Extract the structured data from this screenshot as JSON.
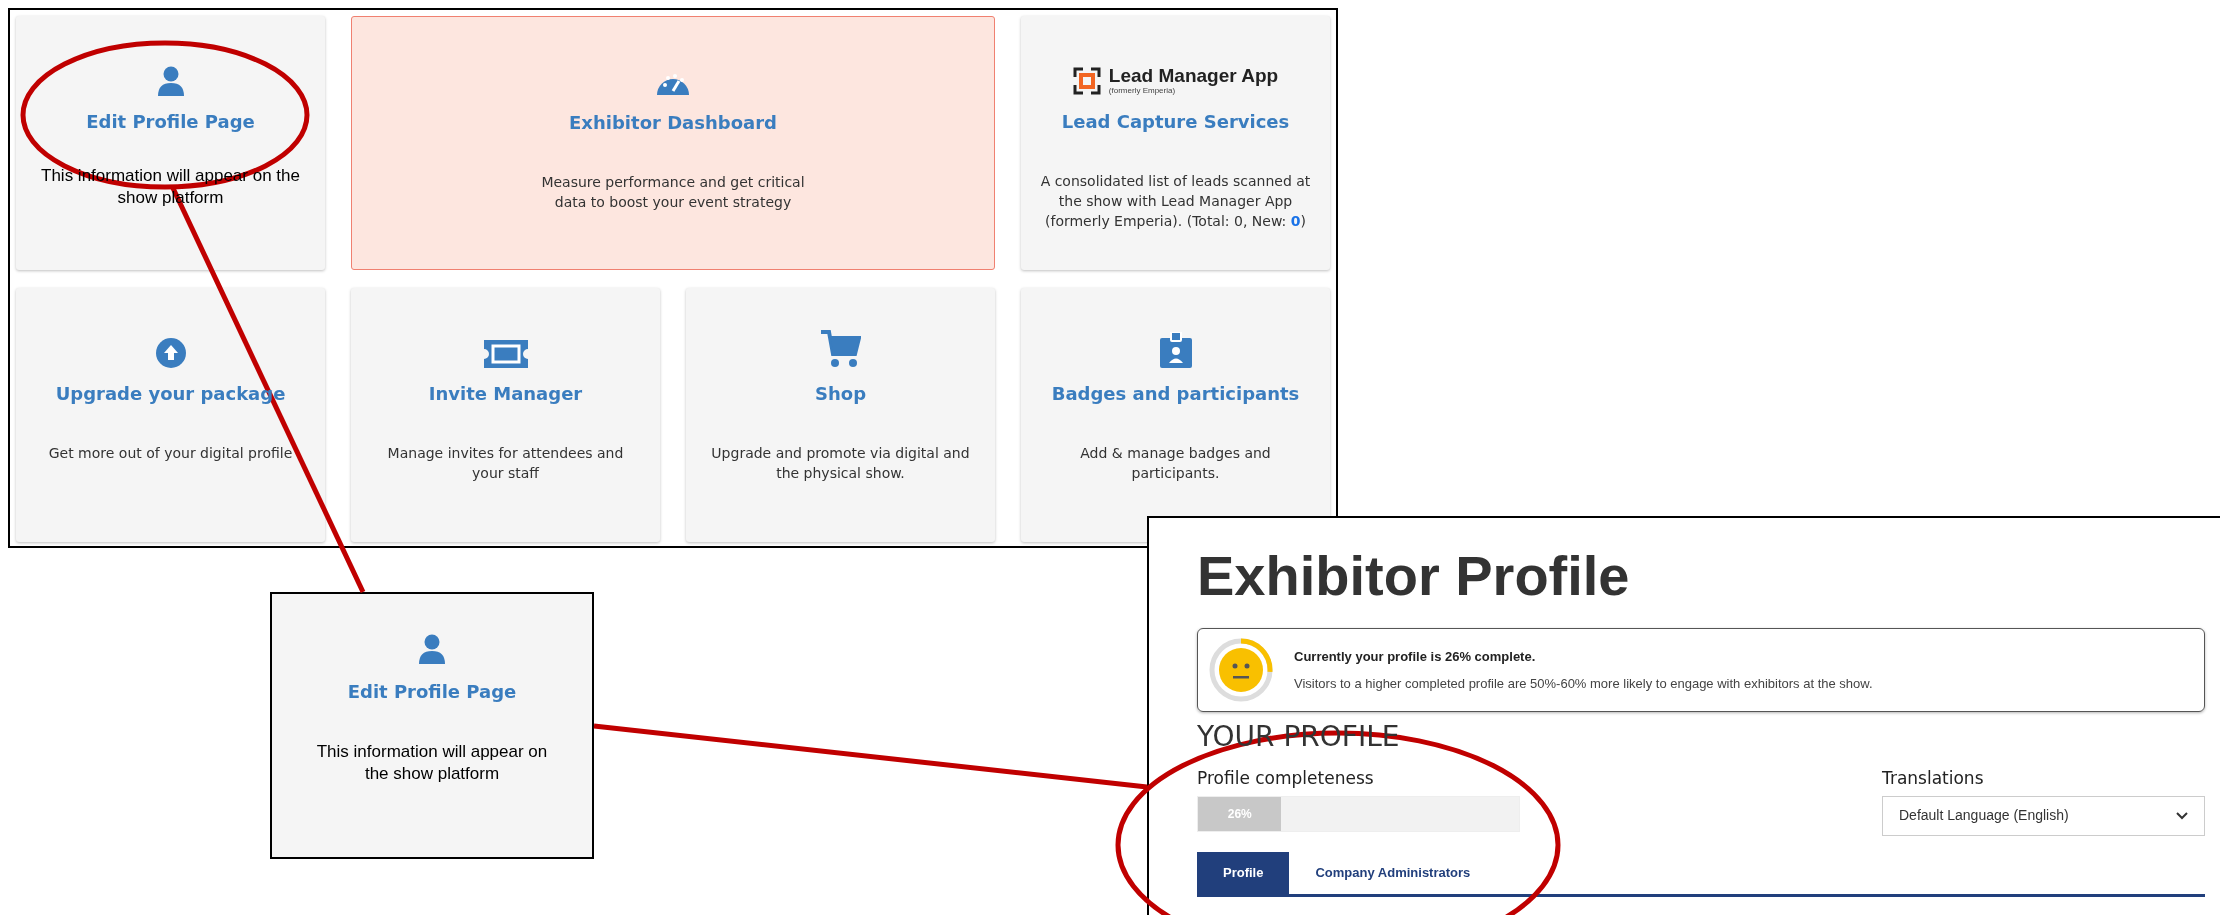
{
  "dashboard": {
    "cards": [
      {
        "kind": "user",
        "title": "Edit Profile Page",
        "description": "This information will appear on the show platform",
        "annotation_note": true,
        "highlighted": false,
        "wide": false
      },
      {
        "kind": "gauge",
        "title": "Exhibitor Dashboard",
        "description": "Measure performance and get critical data to boost your event strategy",
        "annotation_note": false,
        "highlighted": true,
        "wide": true
      },
      {
        "kind": "logo",
        "logo_name": "Lead Manager App",
        "logo_sub": "(formerly Emperia)",
        "title": "Lead Capture Services",
        "description": "A consolidated list of leads scanned at the show with Lead Manager App (formerly Emperia). (Total: 0, New: ",
        "new_count": "0",
        "description_end": ")",
        "annotation_note": false,
        "highlighted": false,
        "wide": false
      },
      {
        "kind": "upload",
        "title": "Upgrade your package",
        "description": "Get more out of your digital profile",
        "annotation_note": false,
        "highlighted": false,
        "wide": false
      },
      {
        "kind": "ticket",
        "title": "Invite Manager",
        "description": "Manage invites for attendees and your staff",
        "annotation_note": false,
        "highlighted": false,
        "wide": false
      },
      {
        "kind": "cart",
        "title": "Shop",
        "description": "Upgrade and promote via digital and the physical show.",
        "annotation_note": false,
        "highlighted": false,
        "wide": false
      },
      {
        "kind": "badge",
        "title": "Badges and participants",
        "description": "Add & manage badges and participants.",
        "annotation_note": false,
        "highlighted": false,
        "wide": false
      }
    ]
  },
  "callout": {
    "kind": "user",
    "title": "Edit Profile Page",
    "description": "This information will appear on the show platform"
  },
  "exhibitor_profile": {
    "title": "Exhibitor Profile",
    "notice": {
      "headline": "Currently your profile is 26% complete.",
      "text": "Visitors to a higher completed profile are 50%-60% more likely to engage with exhibitors at the show."
    },
    "section_title": "YOUR PROFILE",
    "completeness": {
      "label": "Profile completeness",
      "level": 0.26,
      "reading": "26%"
    },
    "translations": {
      "label": "Translations",
      "value": "Default Language (English)"
    },
    "tabs": [
      {
        "label": "Profile",
        "selected": true
      },
      {
        "label": "Company Administrators",
        "selected": false
      }
    ]
  }
}
